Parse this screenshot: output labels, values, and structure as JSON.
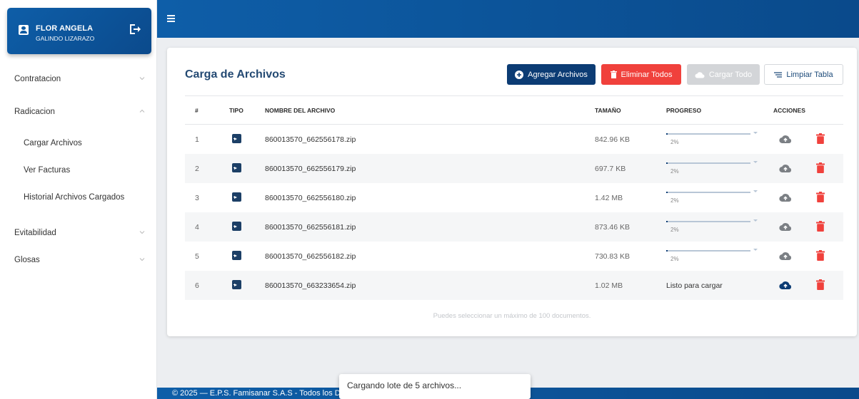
{
  "user": {
    "first_name": "FLOR ANGELA",
    "last_name": "GALINDO LIZARAZO"
  },
  "sidebar": {
    "items": [
      {
        "label": "Contratacion",
        "expanded": false
      },
      {
        "label": "Radicacion",
        "expanded": true,
        "children": [
          "Cargar Archivos",
          "Ver Facturas",
          "Historial Archivos Cargados"
        ]
      },
      {
        "label": "Evitabilidad",
        "expanded": false
      },
      {
        "label": "Glosas",
        "expanded": false
      }
    ]
  },
  "card": {
    "title": "Carga de Archivos",
    "buttons": {
      "add": "Agregar Archivos",
      "delete_all": "Eliminar Todos",
      "load_all": "Cargar Todo",
      "clear": "Limpiar Tabla"
    },
    "columns": {
      "num": "#",
      "type": "TIPO",
      "name": "NOMBRE DEL ARCHIVO",
      "size": "TAMAÑO",
      "progress": "PROGRESO",
      "actions": "ACCIONES"
    },
    "rows": [
      {
        "num": "1",
        "name": "860013570_662556178.zip",
        "size": "842.96 KB",
        "progress": 0.02,
        "progress_label": "2%",
        "status": ""
      },
      {
        "num": "2",
        "name": "860013570_662556179.zip",
        "size": "697.7 KB",
        "progress": 0.02,
        "progress_label": "2%",
        "status": ""
      },
      {
        "num": "3",
        "name": "860013570_662556180.zip",
        "size": "1.42 MB",
        "progress": 0.02,
        "progress_label": "2%",
        "status": ""
      },
      {
        "num": "4",
        "name": "860013570_662556181.zip",
        "size": "873.46 KB",
        "progress": 0.02,
        "progress_label": "2%",
        "status": ""
      },
      {
        "num": "5",
        "name": "860013570_662556182.zip",
        "size": "730.83 KB",
        "progress": 0.02,
        "progress_label": "2%",
        "status": ""
      },
      {
        "num": "6",
        "name": "860013570_663233654.zip",
        "size": "1.02 MB",
        "progress": null,
        "progress_label": "",
        "status": "Listo para cargar"
      }
    ],
    "footnote": "Puedes seleccionar un máximo de 100 documentos."
  },
  "footer": {
    "text": "© 2025 — E.P.S. Famisanar S.A.S - Todos los D"
  },
  "toast": {
    "text": "Cargando lote de 5 archivos..."
  },
  "colors": {
    "primary": "#0c3c74",
    "header": "#0e5ea8",
    "danger": "#f0413c",
    "disabled": "#d3d5d8",
    "upload_idle": "#7b7f84",
    "upload_ready": "#0c3c74"
  },
  "icons": {
    "user": "user-badge-icon",
    "logout": "logout-icon",
    "menu": "hamburger-icon",
    "add": "plus-circle-icon",
    "delete": "trash-icon",
    "cloud": "cloud-upload-icon",
    "clear": "clear-lines-icon",
    "file": "file-zip-icon"
  }
}
